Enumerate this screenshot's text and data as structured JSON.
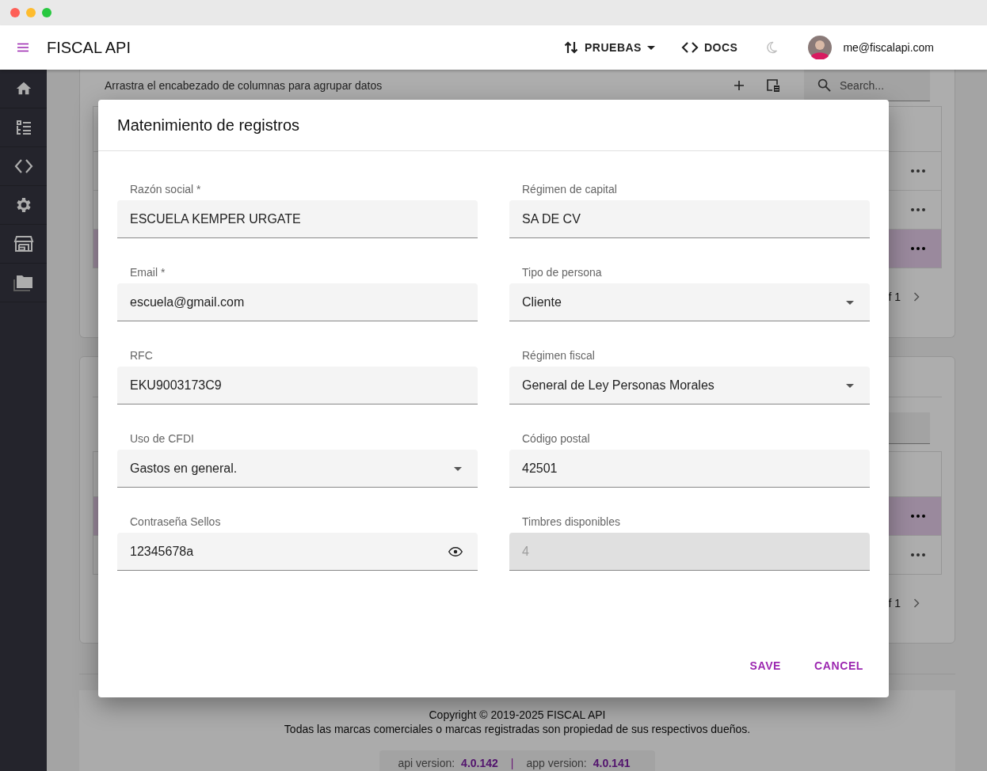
{
  "app_bar": {
    "title": "FISCAL API",
    "env_menu": "PRUEBAS",
    "docs_link": "DOCS",
    "user_email": "me@fiscalapi.com"
  },
  "grid_cards": [
    {
      "group_panel_hint": "Arrastra el encabezado de columnas para agrupar datos",
      "search_placeholder": "Search...",
      "rows": [
        {
          "selected": false
        },
        {
          "selected": false
        },
        {
          "selected": true
        }
      ],
      "pager": "f 1"
    },
    {
      "rows": [
        {
          "selected": true
        },
        {
          "selected": false
        }
      ],
      "pager": "f 1"
    }
  ],
  "footer": {
    "copyright": "Copyright © 2019-2025 FISCAL API",
    "trademark": "Todas las marcas comerciales o marcas registradas son propiedad de sus respectivos dueños.",
    "api_version_label": "api version:",
    "api_version": "4.0.142",
    "separator": "|",
    "app_version_label": "app version:",
    "app_version": "4.0.141"
  },
  "dialog": {
    "title": "Matenimiento de registros",
    "fields": [
      {
        "label": "Razón social *",
        "value": "ESCUELA KEMPER URGATE",
        "kind": "text",
        "disabled": false
      },
      {
        "label": "Régimen de capital",
        "value": "SA DE CV",
        "kind": "text",
        "disabled": false
      },
      {
        "label": "Email *",
        "value": "escuela@gmail.com",
        "kind": "text",
        "disabled": false
      },
      {
        "label": "Tipo de persona",
        "value": "Cliente",
        "kind": "select",
        "disabled": false
      },
      {
        "label": "RFC",
        "value": "EKU9003173C9",
        "kind": "text",
        "disabled": false
      },
      {
        "label": "Régimen fiscal",
        "value": "General de Ley Personas Morales",
        "kind": "select",
        "disabled": false
      },
      {
        "label": "Uso de CFDI",
        "value": "Gastos en general.",
        "kind": "select",
        "disabled": false
      },
      {
        "label": "Código postal",
        "value": "42501",
        "kind": "text",
        "disabled": false
      },
      {
        "label": "Contraseña Sellos",
        "value": "12345678a",
        "kind": "password",
        "disabled": false
      },
      {
        "label": "Timbres disponibles",
        "value": "4",
        "kind": "text",
        "disabled": true
      }
    ],
    "actions": [
      "SAVE",
      "CANCEL"
    ]
  }
}
